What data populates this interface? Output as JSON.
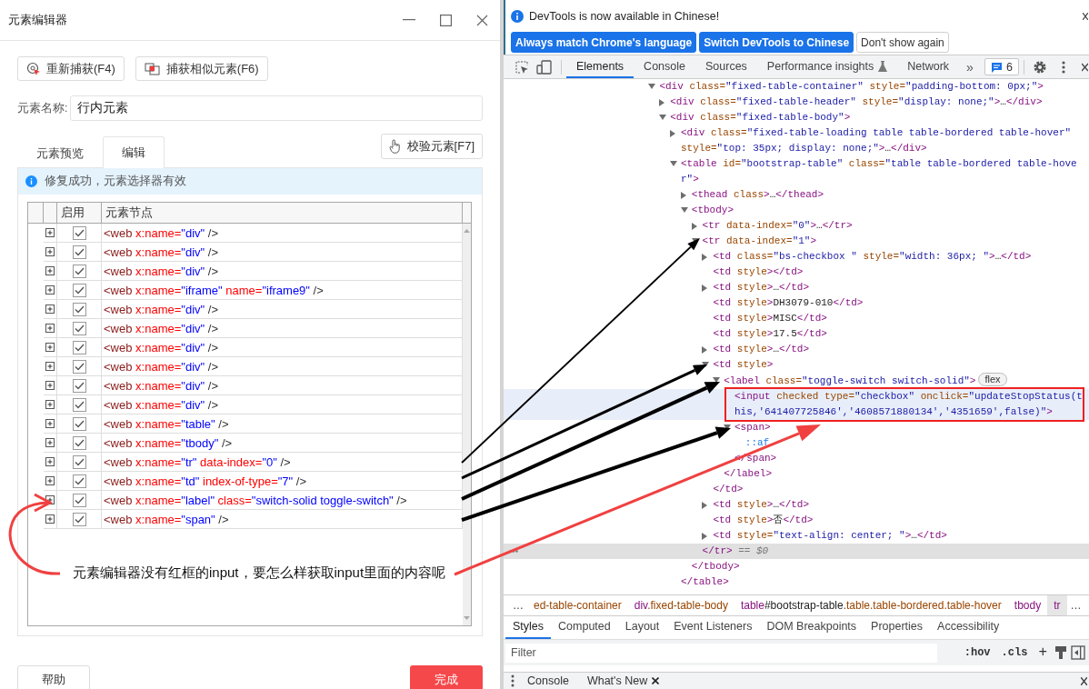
{
  "editor": {
    "title": "元素编辑器",
    "toolbar_buttons": [
      {
        "label": "重新捕获(F4)",
        "kind": "recapture"
      },
      {
        "label": "捕获相似元素(F6)",
        "kind": "similar"
      }
    ],
    "name_field": {
      "label": "元素名称:",
      "value": "行内元素"
    },
    "tabs": [
      {
        "label": "元素预览",
        "selected": false
      },
      {
        "label": "编辑",
        "selected": true
      }
    ],
    "verify_button": "校验元素[F7]",
    "message": "修复成功，元素选择器有效",
    "table": {
      "columns": [
        "启用",
        "元素节点"
      ],
      "rows": [
        {
          "checked": true,
          "code": [
            {
              "kind": "tag",
              "text": "<web"
            },
            {
              "kind": "attr",
              "text": " x:name="
            },
            {
              "kind": "value",
              "text": "\"div\""
            },
            {
              "kind": "punct",
              "text": " />"
            }
          ]
        },
        {
          "checked": true,
          "code": [
            {
              "kind": "tag",
              "text": "<web"
            },
            {
              "kind": "attr",
              "text": " x:name="
            },
            {
              "kind": "value",
              "text": "\"div\""
            },
            {
              "kind": "punct",
              "text": " />"
            }
          ]
        },
        {
          "checked": true,
          "code": [
            {
              "kind": "tag",
              "text": "<web"
            },
            {
              "kind": "attr",
              "text": " x:name="
            },
            {
              "kind": "value",
              "text": "\"div\""
            },
            {
              "kind": "punct",
              "text": " />"
            }
          ]
        },
        {
          "checked": true,
          "code": [
            {
              "kind": "tag",
              "text": "<web"
            },
            {
              "kind": "attr",
              "text": " x:name="
            },
            {
              "kind": "value",
              "text": "\"iframe\""
            },
            {
              "kind": "attr",
              "text": " name="
            },
            {
              "kind": "value",
              "text": "\"iframe9\""
            },
            {
              "kind": "punct",
              "text": " />"
            }
          ]
        },
        {
          "checked": true,
          "code": [
            {
              "kind": "tag",
              "text": "<web"
            },
            {
              "kind": "attr",
              "text": " x:name="
            },
            {
              "kind": "value",
              "text": "\"div\""
            },
            {
              "kind": "punct",
              "text": " />"
            }
          ]
        },
        {
          "checked": true,
          "code": [
            {
              "kind": "tag",
              "text": "<web"
            },
            {
              "kind": "attr",
              "text": " x:name="
            },
            {
              "kind": "value",
              "text": "\"div\""
            },
            {
              "kind": "punct",
              "text": " />"
            }
          ]
        },
        {
          "checked": true,
          "code": [
            {
              "kind": "tag",
              "text": "<web"
            },
            {
              "kind": "attr",
              "text": " x:name="
            },
            {
              "kind": "value",
              "text": "\"div\""
            },
            {
              "kind": "punct",
              "text": " />"
            }
          ]
        },
        {
          "checked": true,
          "code": [
            {
              "kind": "tag",
              "text": "<web"
            },
            {
              "kind": "attr",
              "text": " x:name="
            },
            {
              "kind": "value",
              "text": "\"div\""
            },
            {
              "kind": "punct",
              "text": " />"
            }
          ]
        },
        {
          "checked": true,
          "code": [
            {
              "kind": "tag",
              "text": "<web"
            },
            {
              "kind": "attr",
              "text": " x:name="
            },
            {
              "kind": "value",
              "text": "\"div\""
            },
            {
              "kind": "punct",
              "text": " />"
            }
          ]
        },
        {
          "checked": true,
          "code": [
            {
              "kind": "tag",
              "text": "<web"
            },
            {
              "kind": "attr",
              "text": " x:name="
            },
            {
              "kind": "value",
              "text": "\"div\""
            },
            {
              "kind": "punct",
              "text": " />"
            }
          ]
        },
        {
          "checked": true,
          "code": [
            {
              "kind": "tag",
              "text": "<web"
            },
            {
              "kind": "attr",
              "text": " x:name="
            },
            {
              "kind": "value",
              "text": "\"table\""
            },
            {
              "kind": "punct",
              "text": " />"
            }
          ]
        },
        {
          "checked": true,
          "code": [
            {
              "kind": "tag",
              "text": "<web"
            },
            {
              "kind": "attr",
              "text": " x:name="
            },
            {
              "kind": "value",
              "text": "\"tbody\""
            },
            {
              "kind": "punct",
              "text": " />"
            }
          ]
        },
        {
          "checked": true,
          "code": [
            {
              "kind": "tag",
              "text": "<web"
            },
            {
              "kind": "attr",
              "text": " x:name="
            },
            {
              "kind": "value",
              "text": "\"tr\""
            },
            {
              "kind": "attr",
              "text": " data-index="
            },
            {
              "kind": "value",
              "text": "\"0\""
            },
            {
              "kind": "punct",
              "text": " />"
            }
          ]
        },
        {
          "checked": true,
          "code": [
            {
              "kind": "tag",
              "text": "<web"
            },
            {
              "kind": "attr",
              "text": " x:name="
            },
            {
              "kind": "value",
              "text": "\"td\""
            },
            {
              "kind": "attr",
              "text": " index-of-type="
            },
            {
              "kind": "value",
              "text": "\"7\""
            },
            {
              "kind": "punct",
              "text": " />"
            }
          ]
        },
        {
          "checked": true,
          "code": [
            {
              "kind": "tag",
              "text": "<web"
            },
            {
              "kind": "attr",
              "text": " x:name="
            },
            {
              "kind": "value",
              "text": "\"label\""
            },
            {
              "kind": "attr",
              "text": " class="
            },
            {
              "kind": "value",
              "text": "\"switch-solid toggle-switch\""
            },
            {
              "kind": "punct",
              "text": " />"
            }
          ]
        },
        {
          "checked": true,
          "code": [
            {
              "kind": "tag",
              "text": "<web"
            },
            {
              "kind": "attr",
              "text": " x:name="
            },
            {
              "kind": "value",
              "text": "\"span\""
            },
            {
              "kind": "punct",
              "text": " />"
            }
          ]
        }
      ]
    },
    "footer": {
      "help": "帮助",
      "done": "完成"
    }
  },
  "note": "元素编辑器没有红框的input，要怎么样获取input里面的内容呢",
  "devtools": {
    "banner": {
      "message": "DevTools is now available in Chinese!",
      "buttons": [
        {
          "label": "Always match Chrome's language",
          "kind": "primary"
        },
        {
          "label": "Switch DevTools to Chinese",
          "kind": "primary"
        },
        {
          "label": "Don't show again",
          "kind": "secondary"
        }
      ]
    },
    "tabs": [
      {
        "label": "Elements",
        "selected": true,
        "experimental": false
      },
      {
        "label": "Console",
        "selected": false,
        "experimental": false
      },
      {
        "label": "Sources",
        "selected": false,
        "experimental": false
      },
      {
        "label": "Performance insights",
        "selected": false,
        "experimental": true
      },
      {
        "label": "Network",
        "selected": false,
        "experimental": false
      }
    ],
    "more_tabs": "»",
    "issues_count": "6",
    "tree": [
      {
        "kind": "open",
        "selected": false,
        "hovered": false,
        "boxed": false,
        "parts": [
          {
            "kind": "tag",
            "text": "<div"
          },
          {
            "kind": "attr",
            "text": " class="
          },
          {
            "kind": "value",
            "text": "\"fixed-table-container\""
          },
          {
            "kind": "attr",
            "text": " style="
          },
          {
            "kind": "value",
            "text": "\"padding-bottom: 0px;\""
          },
          {
            "kind": "tag",
            "text": ">"
          }
        ],
        "children": [
          {
            "kind": "closed",
            "selected": false,
            "hovered": false,
            "boxed": false,
            "parts": [
              {
                "kind": "tag",
                "text": "<div"
              },
              {
                "kind": "attr",
                "text": " class="
              },
              {
                "kind": "value",
                "text": "\"fixed-table-header\""
              },
              {
                "kind": "attr",
                "text": " style="
              },
              {
                "kind": "value",
                "text": "\"display: none;\""
              },
              {
                "kind": "tag",
                "text": ">"
              },
              {
                "kind": "text",
                "text": "…"
              },
              {
                "kind": "tag",
                "text": "</div>"
              }
            ]
          },
          {
            "kind": "open",
            "selected": false,
            "hovered": false,
            "boxed": false,
            "parts": [
              {
                "kind": "tag",
                "text": "<div"
              },
              {
                "kind": "attr",
                "text": " class="
              },
              {
                "kind": "value",
                "text": "\"fixed-table-body\""
              },
              {
                "kind": "tag",
                "text": ">"
              }
            ],
            "children": [
              {
                "kind": "closed",
                "selected": false,
                "hovered": false,
                "boxed": false,
                "parts": [
                  {
                    "kind": "tag",
                    "text": "<div"
                  },
                  {
                    "kind": "attr",
                    "text": " class="
                  },
                  {
                    "kind": "value",
                    "text": "\"fixed-table-loading table table-bordered table-hover\""
                  },
                  {
                    "kind": "attr",
                    "text": " style="
                  },
                  {
                    "kind": "value",
                    "text": "\"top: 35px; display: none;\""
                  },
                  {
                    "kind": "tag",
                    "text": ">"
                  },
                  {
                    "kind": "text",
                    "text": "…"
                  },
                  {
                    "kind": "tag",
                    "text": "</div>"
                  }
                ]
              },
              {
                "kind": "open",
                "selected": false,
                "hovered": false,
                "boxed": false,
                "parts": [
                  {
                    "kind": "tag",
                    "text": "<table"
                  },
                  {
                    "kind": "attr",
                    "text": " id="
                  },
                  {
                    "kind": "value",
                    "text": "\"bootstrap-table\""
                  },
                  {
                    "kind": "attr",
                    "text": " class="
                  },
                  {
                    "kind": "value",
                    "text": "\"table table-bordered table-hover\""
                  },
                  {
                    "kind": "tag",
                    "text": ">"
                  }
                ],
                "children": [
                  {
                    "kind": "closed",
                    "selected": false,
                    "hovered": false,
                    "boxed": false,
                    "parts": [
                      {
                        "kind": "tag",
                        "text": "<thead"
                      },
                      {
                        "kind": "attr",
                        "text": " class"
                      },
                      {
                        "kind": "tag",
                        "text": ">"
                      },
                      {
                        "kind": "text",
                        "text": "…"
                      },
                      {
                        "kind": "tag",
                        "text": "</thead>"
                      }
                    ]
                  },
                  {
                    "kind": "open",
                    "selected": false,
                    "hovered": false,
                    "boxed": false,
                    "parts": [
                      {
                        "kind": "tag",
                        "text": "<tbody>"
                      }
                    ],
                    "children": [
                      {
                        "kind": "closed",
                        "selected": false,
                        "hovered": false,
                        "boxed": false,
                        "parts": [
                          {
                            "kind": "tag",
                            "text": "<tr"
                          },
                          {
                            "kind": "attr",
                            "text": " data-index="
                          },
                          {
                            "kind": "value",
                            "text": "\"0\""
                          },
                          {
                            "kind": "tag",
                            "text": ">"
                          },
                          {
                            "kind": "text",
                            "text": "…"
                          },
                          {
                            "kind": "tag",
                            "text": "</tr>"
                          }
                        ]
                      },
                      {
                        "kind": "open",
                        "selected": false,
                        "hovered": false,
                        "boxed": false,
                        "parts": [
                          {
                            "kind": "tag",
                            "text": "<tr"
                          },
                          {
                            "kind": "attr",
                            "text": " data-index="
                          },
                          {
                            "kind": "value",
                            "text": "\"1\""
                          },
                          {
                            "kind": "tag",
                            "text": ">"
                          }
                        ],
                        "children": [
                          {
                            "kind": "closed",
                            "selected": false,
                            "hovered": false,
                            "boxed": false,
                            "parts": [
                              {
                                "kind": "tag",
                                "text": "<td"
                              },
                              {
                                "kind": "attr",
                                "text": " class="
                              },
                              {
                                "kind": "value",
                                "text": "\"bs-checkbox \""
                              },
                              {
                                "kind": "attr",
                                "text": " style="
                              },
                              {
                                "kind": "value",
                                "text": "\"width: 36px; \""
                              },
                              {
                                "kind": "tag",
                                "text": ">"
                              },
                              {
                                "kind": "text",
                                "text": "…"
                              },
                              {
                                "kind": "tag",
                                "text": "</td>"
                              }
                            ]
                          },
                          {
                            "kind": "leaf",
                            "selected": false,
                            "hovered": false,
                            "boxed": false,
                            "parts": [
                              {
                                "kind": "tag",
                                "text": "<td"
                              },
                              {
                                "kind": "attr",
                                "text": " style"
                              },
                              {
                                "kind": "tag",
                                "text": "></td>"
                              }
                            ]
                          },
                          {
                            "kind": "closed",
                            "selected": false,
                            "hovered": false,
                            "boxed": false,
                            "parts": [
                              {
                                "kind": "tag",
                                "text": "<td"
                              },
                              {
                                "kind": "attr",
                                "text": " style"
                              },
                              {
                                "kind": "tag",
                                "text": ">"
                              },
                              {
                                "kind": "text",
                                "text": "…"
                              },
                              {
                                "kind": "tag",
                                "text": "</td>"
                              }
                            ]
                          },
                          {
                            "kind": "leaf",
                            "selected": false,
                            "hovered": false,
                            "boxed": false,
                            "parts": [
                              {
                                "kind": "tag",
                                "text": "<td"
                              },
                              {
                                "kind": "attr",
                                "text": " style"
                              },
                              {
                                "kind": "tag",
                                "text": ">"
                              },
                              {
                                "kind": "text",
                                "text": "DH3079-010"
                              },
                              {
                                "kind": "tag",
                                "text": "</td>"
                              }
                            ]
                          },
                          {
                            "kind": "leaf",
                            "selected": false,
                            "hovered": false,
                            "boxed": false,
                            "parts": [
                              {
                                "kind": "tag",
                                "text": "<td"
                              },
                              {
                                "kind": "attr",
                                "text": " style"
                              },
                              {
                                "kind": "tag",
                                "text": ">"
                              },
                              {
                                "kind": "text",
                                "text": "MISC"
                              },
                              {
                                "kind": "tag",
                                "text": "</td>"
                              }
                            ]
                          },
                          {
                            "kind": "leaf",
                            "selected": false,
                            "hovered": false,
                            "boxed": false,
                            "parts": [
                              {
                                "kind": "tag",
                                "text": "<td"
                              },
                              {
                                "kind": "attr",
                                "text": " style"
                              },
                              {
                                "kind": "tag",
                                "text": ">"
                              },
                              {
                                "kind": "text",
                                "text": "17.5"
                              },
                              {
                                "kind": "tag",
                                "text": "</td>"
                              }
                            ]
                          },
                          {
                            "kind": "closed",
                            "selected": false,
                            "hovered": false,
                            "boxed": false,
                            "parts": [
                              {
                                "kind": "tag",
                                "text": "<td"
                              },
                              {
                                "kind": "attr",
                                "text": " style"
                              },
                              {
                                "kind": "tag",
                                "text": ">"
                              },
                              {
                                "kind": "text",
                                "text": "…"
                              },
                              {
                                "kind": "tag",
                                "text": "</td>"
                              }
                            ]
                          },
                          {
                            "kind": "open",
                            "selected": false,
                            "hovered": false,
                            "boxed": false,
                            "parts": [
                              {
                                "kind": "tag",
                                "text": "<td"
                              },
                              {
                                "kind": "attr",
                                "text": " style"
                              },
                              {
                                "kind": "tag",
                                "text": ">"
                              }
                            ],
                            "children": [
                              {
                                "kind": "open",
                                "selected": false,
                                "hovered": false,
                                "boxed": false,
                                "badge": "flex",
                                "parts": [
                                  {
                                    "kind": "tag",
                                    "text": "<label"
                                  },
                                  {
                                    "kind": "attr",
                                    "text": " class="
                                  },
                                  {
                                    "kind": "value",
                                    "text": "\"toggle-switch switch-solid\""
                                  },
                                  {
                                    "kind": "tag",
                                    "text": ">"
                                  }
                                ],
                                "children": [
                                  {
                                    "kind": "leaf",
                                    "selected": false,
                                    "hovered": true,
                                    "boxed": true,
                                    "parts": [
                                      {
                                        "kind": "tag",
                                        "text": "<input"
                                      },
                                      {
                                        "kind": "attr",
                                        "text": " checked type="
                                      },
                                      {
                                        "kind": "value",
                                        "text": "\"checkbox\""
                                      },
                                      {
                                        "kind": "attr",
                                        "text": " onclick="
                                      },
                                      {
                                        "kind": "value",
                                        "text": "\"updateStopStatus(this,'641407725846','4608571880134','4351659',false)\""
                                      },
                                      {
                                        "kind": "tag",
                                        "text": ">"
                                      }
                                    ]
                                  },
                                  {
                                    "kind": "open",
                                    "selected": false,
                                    "hovered": false,
                                    "boxed": false,
                                    "parts": [
                                      {
                                        "kind": "tag",
                                        "text": "<span>"
                                      }
                                    ],
                                    "children": [
                                      {
                                        "kind": "leaf",
                                        "selected": false,
                                        "hovered": false,
                                        "boxed": false,
                                        "parts": [
                                          {
                                            "kind": "pseudo",
                                            "text": "::af"
                                          }
                                        ]
                                      }
                                    ]
                                  },
                                  {
                                    "kind": "leaf",
                                    "selected": false,
                                    "hovered": false,
                                    "boxed": false,
                                    "parts": [
                                      {
                                        "kind": "tag",
                                        "text": "</span>"
                                      }
                                    ]
                                  }
                                ]
                              },
                              {
                                "kind": "leaf",
                                "selected": false,
                                "hovered": false,
                                "boxed": false,
                                "parts": [
                                  {
                                    "kind": "tag",
                                    "text": "</label>"
                                  }
                                ]
                              }
                            ]
                          },
                          {
                            "kind": "leaf",
                            "selected": false,
                            "hovered": false,
                            "boxed": false,
                            "parts": [
                              {
                                "kind": "tag",
                                "text": "</td>"
                              }
                            ]
                          },
                          {
                            "kind": "closed",
                            "selected": false,
                            "hovered": false,
                            "boxed": false,
                            "parts": [
                              {
                                "kind": "tag",
                                "text": "<td"
                              },
                              {
                                "kind": "attr",
                                "text": " style"
                              },
                              {
                                "kind": "tag",
                                "text": ">"
                              },
                              {
                                "kind": "text",
                                "text": "…"
                              },
                              {
                                "kind": "tag",
                                "text": "</td>"
                              }
                            ]
                          },
                          {
                            "kind": "leaf",
                            "selected": false,
                            "hovered": false,
                            "boxed": false,
                            "parts": [
                              {
                                "kind": "tag",
                                "text": "<td"
                              },
                              {
                                "kind": "attr",
                                "text": " style"
                              },
                              {
                                "kind": "tag",
                                "text": ">"
                              },
                              {
                                "kind": "text",
                                "text": "否"
                              },
                              {
                                "kind": "tag",
                                "text": "</td>"
                              }
                            ]
                          },
                          {
                            "kind": "closed",
                            "selected": false,
                            "hovered": false,
                            "boxed": false,
                            "parts": [
                              {
                                "kind": "tag",
                                "text": "<td"
                              },
                              {
                                "kind": "attr",
                                "text": " style="
                              },
                              {
                                "kind": "value",
                                "text": "\"text-align: center; \""
                              },
                              {
                                "kind": "tag",
                                "text": ">"
                              },
                              {
                                "kind": "text",
                                "text": "…"
                              },
                              {
                                "kind": "tag",
                                "text": "</td>"
                              }
                            ]
                          }
                        ]
                      },
                      {
                        "kind": "leaf",
                        "selected": true,
                        "hovered": false,
                        "boxed": false,
                        "parts": [
                          {
                            "kind": "tag",
                            "text": "</tr>"
                          },
                          {
                            "kind": "comment",
                            "text": " == $0"
                          }
                        ]
                      }
                    ]
                  },
                  {
                    "kind": "leaf",
                    "selected": false,
                    "hovered": false,
                    "boxed": false,
                    "parts": [
                      {
                        "kind": "tag",
                        "text": "</tbody>"
                      }
                    ]
                  }
                ]
              },
              {
                "kind": "leaf",
                "selected": false,
                "hovered": false,
                "boxed": false,
                "parts": [
                  {
                    "kind": "tag",
                    "text": "</table>"
                  }
                ]
              }
            ]
          }
        ]
      }
    ],
    "breadcrumbs": {
      "scroll_left": "…",
      "scroll_right": "…",
      "items": [
        {
          "selected": false,
          "parts": [
            {
              "kind": "class",
              "text": "ed-table-container"
            }
          ]
        },
        {
          "selected": false,
          "parts": [
            {
              "kind": "tag",
              "text": "div"
            },
            {
              "kind": "class",
              "text": ".fixed-table-body"
            }
          ]
        },
        {
          "selected": false,
          "parts": [
            {
              "kind": "tag",
              "text": "table"
            },
            {
              "kind": "id",
              "text": "#bootstrap-table"
            },
            {
              "kind": "class",
              "text": ".table.table-bordered.table-hover"
            }
          ]
        },
        {
          "selected": false,
          "parts": [
            {
              "kind": "tag",
              "text": "tbody"
            }
          ]
        },
        {
          "selected": true,
          "parts": [
            {
              "kind": "tag",
              "text": "tr"
            }
          ]
        }
      ]
    },
    "pane_tabs": [
      {
        "label": "Styles",
        "selected": true
      },
      {
        "label": "Computed",
        "selected": false
      },
      {
        "label": "Layout",
        "selected": false
      },
      {
        "label": "Event Listeners",
        "selected": false
      },
      {
        "label": "DOM Breakpoints",
        "selected": false
      },
      {
        "label": "Properties",
        "selected": false
      },
      {
        "label": "Accessibility",
        "selected": false
      }
    ],
    "filter": {
      "placeholder": "Filter",
      "hov": ":hov",
      "cls": ".cls",
      "add": "+"
    },
    "drawer_tabs": [
      {
        "label": "Console",
        "closable": false
      },
      {
        "label": "What's New",
        "closable": true
      }
    ]
  }
}
